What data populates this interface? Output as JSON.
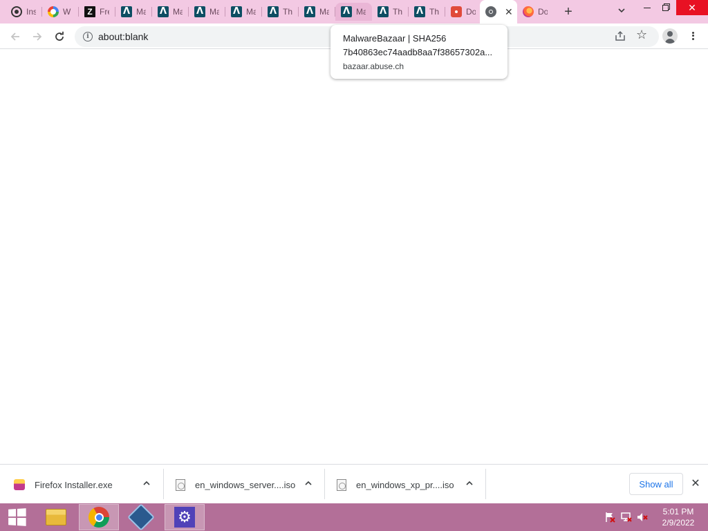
{
  "browser": {
    "tabs": [
      {
        "title": "Ins",
        "icon": "spider-icon"
      },
      {
        "title": "W",
        "icon": "google-icon"
      },
      {
        "title": "Fre",
        "icon": "zotero-icon"
      },
      {
        "title": "Ma",
        "icon": "any-run-icon"
      },
      {
        "title": "Ma",
        "icon": "any-run-icon"
      },
      {
        "title": "Ma",
        "icon": "any-run-icon"
      },
      {
        "title": "Ma",
        "icon": "any-run-icon"
      },
      {
        "title": "Th",
        "icon": "any-run-icon"
      },
      {
        "title": "Ma",
        "icon": "any-run-icon"
      },
      {
        "title": "Ma",
        "icon": "any-run-icon"
      },
      {
        "title": "Th",
        "icon": "any-run-icon"
      },
      {
        "title": "Th",
        "icon": "any-run-icon"
      },
      {
        "title": "Do",
        "icon": "malwarebazaar-icon"
      },
      {
        "title": "",
        "icon": "globe-icon",
        "active": true
      },
      {
        "title": "Do",
        "icon": "firefox-icon"
      }
    ],
    "new_tab_label": "+",
    "address_bar": {
      "url": "about:blank"
    },
    "tooltip": {
      "title": "MalwareBazaar | SHA256",
      "hash": "7b40863ec74aadb8aa7f38657302a...",
      "domain": "bazaar.abuse.ch"
    }
  },
  "downloads": {
    "items": [
      {
        "name": "Firefox Installer.exe",
        "icon": "firefox-installer-icon"
      },
      {
        "name": "en_windows_server....iso",
        "icon": "file-icon"
      },
      {
        "name": "en_windows_xp_pr....iso",
        "icon": "file-icon"
      }
    ],
    "show_all_label": "Show all"
  },
  "taskbar": {
    "apps": [
      "file-explorer-icon",
      "chrome-icon",
      "virtualbox-icon",
      "settings-icon"
    ],
    "clock": {
      "time": "5:01 PM",
      "date": "2/9/2022"
    }
  },
  "colors": {
    "tab_strip": "#f3c9e3",
    "taskbar": "#b36f98",
    "accent_link": "#1a73e8"
  }
}
